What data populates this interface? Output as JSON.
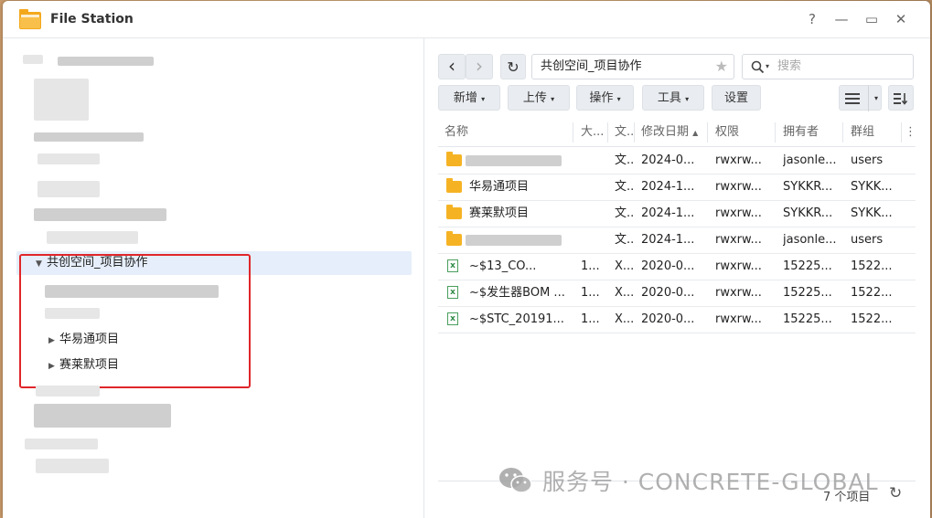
{
  "window": {
    "title": "File Station",
    "controls": {
      "help": "?",
      "minimize": "—",
      "maximize": "▭",
      "close": "✕"
    }
  },
  "tree": {
    "selected_folder": "共创空间_项目协作",
    "children": [
      {
        "label": "华易通项目"
      },
      {
        "label": "赛莱默项目"
      }
    ]
  },
  "toolbar": {
    "back_icon": "‹",
    "forward_icon": "›",
    "refresh_icon": "↻",
    "path": "共创空间_项目协作",
    "star_icon": "★",
    "search_placeholder": "搜索",
    "buttons": {
      "create": "新增",
      "upload": "上传",
      "action": "操作",
      "tools": "工具",
      "settings": "设置"
    }
  },
  "table": {
    "columns": {
      "name": "名称",
      "size": "大...",
      "type": "文...",
      "modified": "修改日期",
      "permission": "权限",
      "owner": "拥有者",
      "group": "群组"
    },
    "rows": [
      {
        "icon": "folder",
        "name": "",
        "size": "",
        "type": "文...",
        "modified": "2024-0...",
        "permission": "rwxrw...",
        "owner": "jasonle...",
        "group": "users"
      },
      {
        "icon": "folder",
        "name": "华易通项目",
        "size": "",
        "type": "文...",
        "modified": "2024-1...",
        "permission": "rwxrw...",
        "owner": "SYKKR...",
        "group": "SYKK..."
      },
      {
        "icon": "folder",
        "name": "赛莱默项目",
        "size": "",
        "type": "文...",
        "modified": "2024-1...",
        "permission": "rwxrw...",
        "owner": "SYKKR...",
        "group": "SYKK..."
      },
      {
        "icon": "folder",
        "name": "",
        "size": "",
        "type": "文...",
        "modified": "2024-1...",
        "permission": "rwxrw...",
        "owner": "jasonle...",
        "group": "users"
      },
      {
        "icon": "excel",
        "name": "~$13_CO...",
        "size": "1...",
        "type": "X...",
        "modified": "2020-0...",
        "permission": "rwxrw...",
        "owner": "15225...",
        "group": "1522..."
      },
      {
        "icon": "excel",
        "name": "~$发生器BOM ...",
        "size": "1...",
        "type": "X...",
        "modified": "2020-0...",
        "permission": "rwxrw...",
        "owner": "15225...",
        "group": "1522..."
      },
      {
        "icon": "excel",
        "name": "~$STC_20191...",
        "size": "1...",
        "type": "X...",
        "modified": "2020-0...",
        "permission": "rwxrw...",
        "owner": "15225...",
        "group": "1522..."
      }
    ]
  },
  "status": {
    "count": "7 个项目"
  },
  "watermark": "服务号 · CONCRETE-GLOBAL"
}
